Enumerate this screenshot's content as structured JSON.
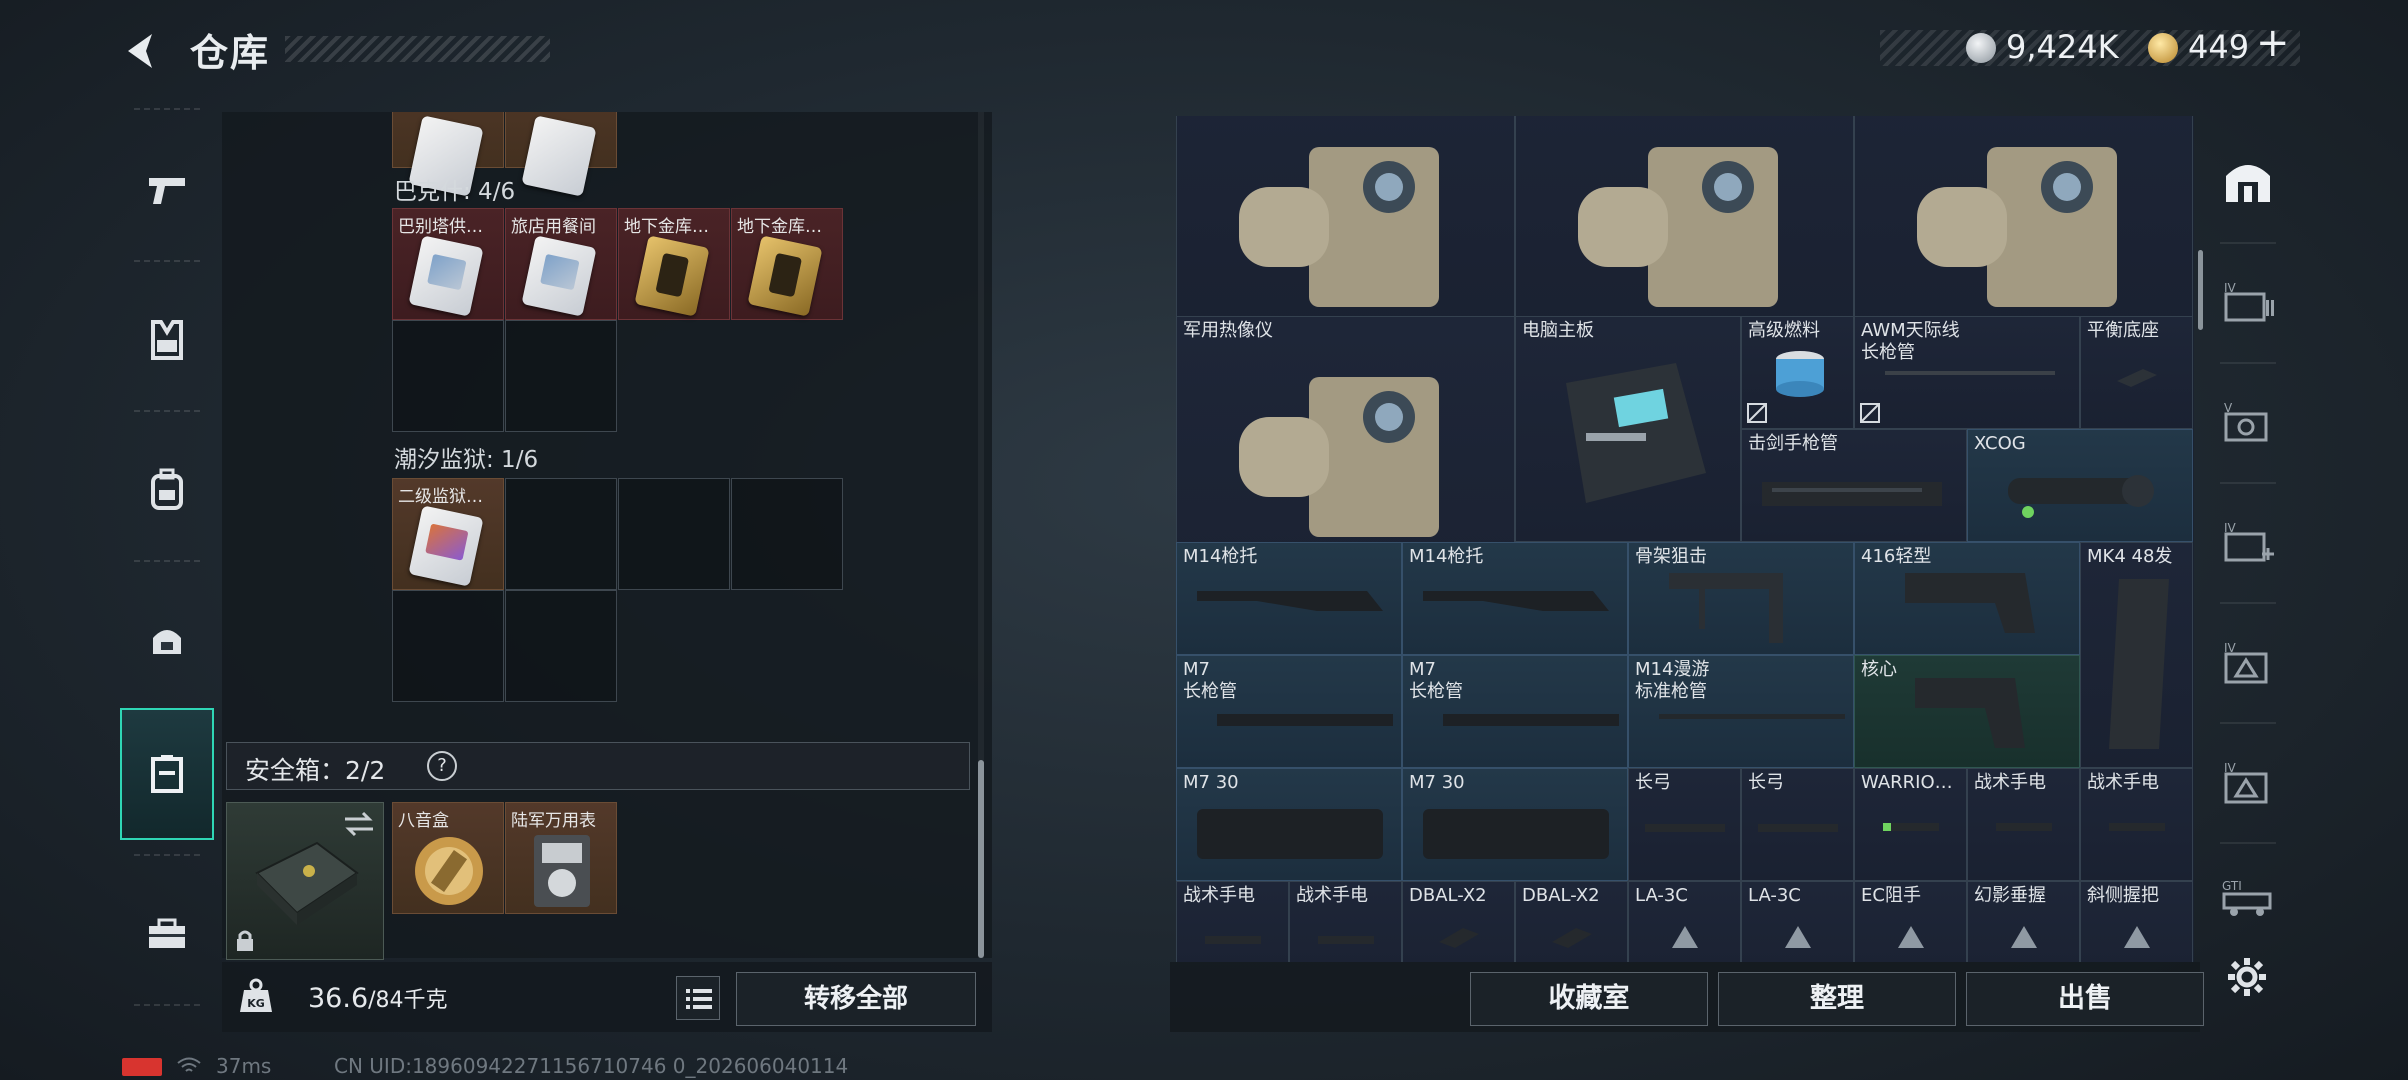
{
  "header": {
    "title": "仓库",
    "currency_1": "9,424K",
    "currency_2": "449",
    "plus": "+"
  },
  "categories": [
    {
      "icon": "pistol-icon",
      "active": false
    },
    {
      "icon": "vest-icon",
      "active": false
    },
    {
      "icon": "backpack-icon",
      "active": false
    },
    {
      "icon": "helmet-bag-icon",
      "active": false
    },
    {
      "icon": "container-icon",
      "active": true
    },
    {
      "icon": "toolbox-icon",
      "active": false
    }
  ],
  "stash": {
    "group_1": {
      "label": "巴克什: 4/6",
      "items": [
        "巴别塔供…",
        "旅店用餐间",
        "地下金库…",
        "地下金库…"
      ]
    },
    "group_2": {
      "label": "潮汐监狱: 1/6",
      "items": [
        "二级监狱…"
      ]
    },
    "safe_label": "安全箱：2/2",
    "help": "?",
    "safe_items": [
      "八音盒",
      "陆军万用表"
    ],
    "weight_value": "36.6",
    "weight_unit": "/84千克",
    "kg_label": "KG",
    "transfer_all": "转移全部"
  },
  "items": [
    {
      "label": "军用热像仪"
    },
    {
      "label": "电脑主板"
    },
    {
      "label": "高级燃料",
      "no_trade": true
    },
    {
      "label": "AWM天际线\n长枪管",
      "no_trade": true
    },
    {
      "label": "平衡底座"
    },
    {
      "label": "击剑手枪管"
    },
    {
      "label": "XCOG"
    },
    {
      "label": "M14枪托"
    },
    {
      "label": "M14枪托"
    },
    {
      "label": "骨架狙击"
    },
    {
      "label": "416轻型"
    },
    {
      "label": "MK4 48发"
    },
    {
      "label": "M7\n长枪管"
    },
    {
      "label": "M7\n长枪管"
    },
    {
      "label": "M14漫游\n标准枪管"
    },
    {
      "label": "核心"
    },
    {
      "label": "M7 30"
    },
    {
      "label": "M7 30"
    },
    {
      "label": "长弓"
    },
    {
      "label": "长弓"
    },
    {
      "label": "WARRIO…"
    },
    {
      "label": "战术手电"
    },
    {
      "label": "战术手电"
    },
    {
      "label": "战术手电"
    },
    {
      "label": "战术手电"
    },
    {
      "label": "DBAL-X2"
    },
    {
      "label": "DBAL-X2"
    },
    {
      "label": "LA-3C"
    },
    {
      "label": "LA-3C"
    },
    {
      "label": "EC阻手"
    },
    {
      "label": "幻影垂握"
    },
    {
      "label": "斜侧握把"
    }
  ],
  "actions": {
    "collection": "收藏室",
    "sort": "整理",
    "sell": "出售"
  },
  "side_tabs": [
    {
      "icon": "home-icon",
      "active": true
    },
    {
      "label": "IV",
      "icon": "folder-icon"
    },
    {
      "label": "V",
      "icon": "camera-icon"
    },
    {
      "label": "IV",
      "icon": "medkit-icon"
    },
    {
      "label": "IV",
      "icon": "triangle-box-icon"
    },
    {
      "label": "IV",
      "icon": "triangle-box-icon"
    },
    {
      "label": "GTI",
      "icon": "vehicle-icon"
    }
  ],
  "status": {
    "ping": "37ms",
    "uid": "CN UID:18960942271156710746 0_202606040114"
  },
  "colors": {
    "accent": "#2fd6b5",
    "red_slot": "#4a2326",
    "brown_slot": "#53392a",
    "item_panel": "#1a2230"
  }
}
